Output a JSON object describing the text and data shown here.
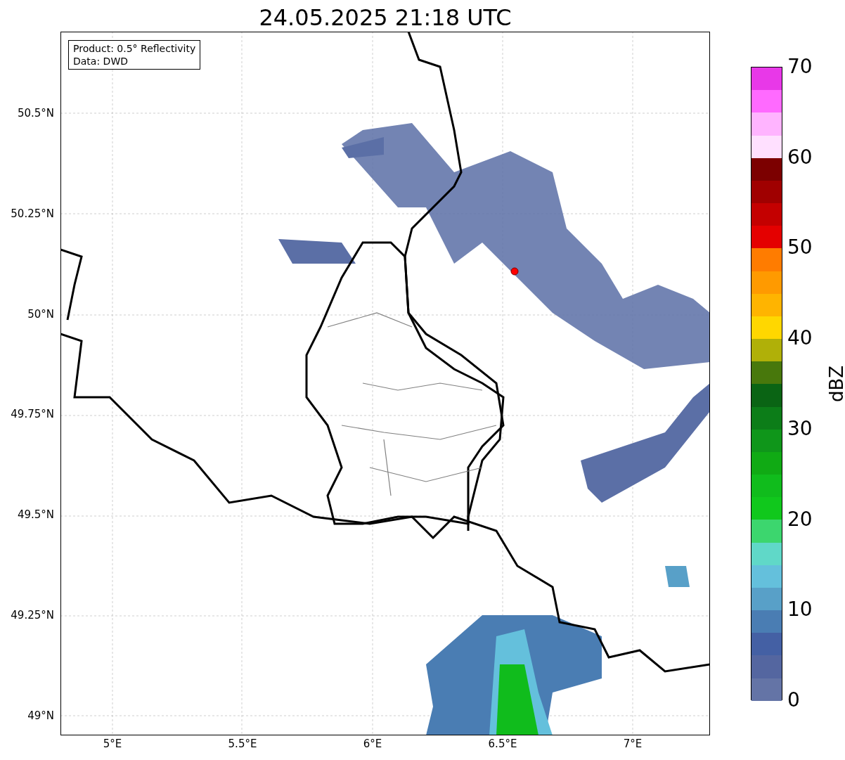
{
  "title": "24.05.2025 21:18 UTC",
  "legend": [
    "Product: 0.5° Reflectivity",
    "Data: DWD"
  ],
  "map": {
    "yticks": [
      "50.5°N",
      "50.25°N",
      "50°N",
      "49.75°N",
      "49.5°N",
      "49.25°N",
      "49°N"
    ],
    "xticks": [
      "5°E",
      "5.5°E",
      "6°E",
      "6.5°E",
      "7°E"
    ]
  },
  "colorbar": {
    "label": "dBZ",
    "ticks": [
      "70",
      "60",
      "50",
      "40",
      "30",
      "20",
      "10",
      "0"
    ],
    "bins": [
      {
        "color": "#e838e8"
      },
      {
        "color": "#ff6aff"
      },
      {
        "color": "#ffb4ff"
      },
      {
        "color": "#ffe0ff"
      },
      {
        "color": "#7c0000"
      },
      {
        "color": "#a00000"
      },
      {
        "color": "#c40000"
      },
      {
        "color": "#e40000"
      },
      {
        "color": "#ff7c00"
      },
      {
        "color": "#ff9a00"
      },
      {
        "color": "#ffb400"
      },
      {
        "color": "#ffd700"
      },
      {
        "color": "#b0b008"
      },
      {
        "color": "#48780c"
      },
      {
        "color": "#0a6414"
      },
      {
        "color": "#0c7d18"
      },
      {
        "color": "#0f961a"
      },
      {
        "color": "#10aa14"
      },
      {
        "color": "#10bc1c"
      },
      {
        "color": "#10c81c"
      },
      {
        "color": "#3cd66e"
      },
      {
        "color": "#60d8c8"
      },
      {
        "color": "#64c0dc"
      },
      {
        "color": "#58a0c8"
      },
      {
        "color": "#4a7db3"
      },
      {
        "color": "#4460a4"
      },
      {
        "color": "#5466a0"
      },
      {
        "color": "#6474a6"
      }
    ]
  }
}
